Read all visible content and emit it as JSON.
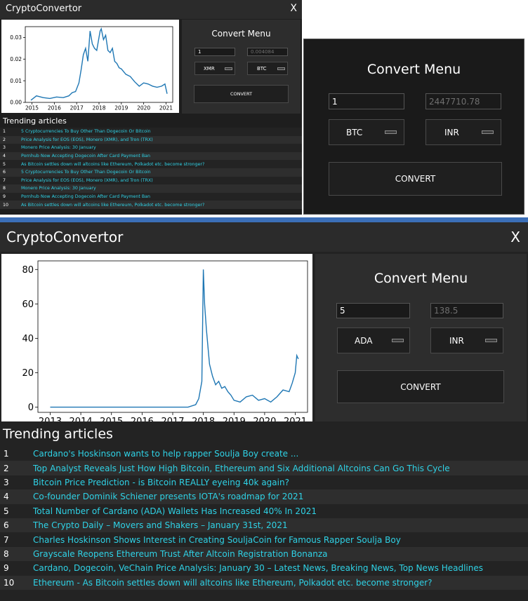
{
  "window_small": {
    "title": "CryptoConvertor",
    "close_label": "X",
    "menu": {
      "title": "Convert Menu",
      "amount": "1",
      "result": "0.004084",
      "from_currency": "XMR",
      "to_currency": "BTC",
      "convert_label": "CONVERT"
    },
    "trending_title": "Trending articles",
    "articles": [
      {
        "num": "1",
        "title": "5 Cryptocurrencies To Buy Other Than Dogecoin Or Bitcoin"
      },
      {
        "num": "2",
        "title": "Price Analysis for EOS (EOS), Monero (XMR), and Tron (TRX)"
      },
      {
        "num": "3",
        "title": "Monero Price Analysis: 30 January"
      },
      {
        "num": "4",
        "title": "Pornhub Now Accepting Dogecoin After Card Payment Ban"
      },
      {
        "num": "5",
        "title": "As Bitcoin settles down will altcoins like Ethereum, Polkadot etc. become stronger?"
      },
      {
        "num": "6",
        "title": "5 Cryptocurrencies To Buy Other Than Dogecoin Or Bitcoin"
      },
      {
        "num": "7",
        "title": "Price Analysis for EOS (EOS), Monero (XMR), and Tron (TRX)"
      },
      {
        "num": "8",
        "title": "Monero Price Analysis: 30 January"
      },
      {
        "num": "9",
        "title": "Pornhub Now Accepting Dogecoin After Card Payment Ban"
      },
      {
        "num": "10",
        "title": "As Bitcoin settles down will altcoins like Ethereum, Polkadot etc. become stronger?"
      }
    ]
  },
  "convert_menu_zoom": {
    "title": "Convert Menu",
    "amount": "1",
    "result": "2447710.78",
    "from_currency": "BTC",
    "to_currency": "INR",
    "convert_label": "CONVERT"
  },
  "window_large": {
    "title": "CryptoConvertor",
    "close_label": "X",
    "menu": {
      "title": "Convert Menu",
      "amount": "5",
      "result": "138.5",
      "from_currency": "ADA",
      "to_currency": "INR",
      "convert_label": "CONVERT"
    },
    "trending_title": "Trending articles",
    "articles": [
      {
        "num": "1",
        "title": "Cardano's Hoskinson wants to help rapper Soulja Boy create ..."
      },
      {
        "num": "2",
        "title": "Top Analyst Reveals Just How High Bitcoin, Ethereum and Six Additional Altcoins Can Go This Cycle"
      },
      {
        "num": "3",
        "title": "Bitcoin Price Prediction - is Bitcoin REALLY eyeing 40k again?"
      },
      {
        "num": "4",
        "title": "Co-founder Dominik Schiener presents IOTA's roadmap for 2021"
      },
      {
        "num": "5",
        "title": "Total Number of Cardano (ADA) Wallets Has Increased 40% In 2021"
      },
      {
        "num": "6",
        "title": "The Crypto Daily – Movers and Shakers – January 31st, 2021"
      },
      {
        "num": "7",
        "title": "Charles Hoskinson Shows Interest in Creating SouljaCoin for Famous Rapper Soulja Boy"
      },
      {
        "num": "8",
        "title": "Grayscale Reopens Ethereum Trust After Altcoin Registration Bonanza"
      },
      {
        "num": "9",
        "title": "Cardano, Dogecoin, VeChain Price Analysis: January 30 – Latest News, Breaking News, Top News Headlines"
      },
      {
        "num": "10",
        "title": "Ethereum - As Bitcoin settles down will altcoins like Ethereum, Polkadot etc. become stronger?"
      }
    ]
  },
  "chart_data": [
    {
      "type": "line",
      "x_tick_labels": [
        "2015",
        "2016",
        "2017",
        "2018",
        "2019",
        "2020",
        "2021"
      ],
      "y_tick_labels": [
        "0.00",
        "0.01",
        "0.02",
        "0.03"
      ],
      "xlim": [
        2014.7,
        2021.3
      ],
      "ylim": [
        0.0,
        0.035
      ],
      "line_color": "#1f77b4",
      "series": [
        {
          "x": [
            2014.95,
            2015.2,
            2015.5,
            2015.8,
            2016.1,
            2016.4,
            2016.65,
            2016.8,
            2016.95,
            2017.1,
            2017.2,
            2017.3,
            2017.4,
            2017.5,
            2017.6,
            2017.7,
            2017.8,
            2017.9,
            2018.0,
            2018.05,
            2018.1,
            2018.2,
            2018.3,
            2018.4,
            2018.5,
            2018.6,
            2018.7,
            2018.8,
            2018.9,
            2019.0,
            2019.2,
            2019.4,
            2019.6,
            2019.8,
            2020.0,
            2020.2,
            2020.4,
            2020.6,
            2020.8,
            2020.95,
            2021.05
          ],
          "y": [
            0.001,
            0.003,
            0.0022,
            0.0018,
            0.0025,
            0.0022,
            0.003,
            0.0045,
            0.005,
            0.009,
            0.015,
            0.022,
            0.025,
            0.019,
            0.033,
            0.027,
            0.025,
            0.024,
            0.03,
            0.033,
            0.034,
            0.029,
            0.031,
            0.024,
            0.023,
            0.025,
            0.019,
            0.018,
            0.016,
            0.0155,
            0.013,
            0.012,
            0.0095,
            0.0075,
            0.009,
            0.0085,
            0.0075,
            0.007,
            0.0075,
            0.0085,
            0.004
          ]
        }
      ]
    },
    {
      "type": "line",
      "x_tick_labels": [
        "2013",
        "2014",
        "2015",
        "2016",
        "2017",
        "2018",
        "2019",
        "2020",
        "2021"
      ],
      "y_tick_labels": [
        "0",
        "20",
        "40",
        "60",
        "80"
      ],
      "xlim": [
        2012.6,
        2021.4
      ],
      "ylim": [
        -3,
        85
      ],
      "line_color": "#1f77b4",
      "series": [
        {
          "x": [
            2013.0,
            2014.0,
            2015.0,
            2016.0,
            2017.0,
            2017.5,
            2017.75,
            2017.85,
            2017.95,
            2018.0,
            2018.04,
            2018.1,
            2018.2,
            2018.3,
            2018.4,
            2018.5,
            2018.6,
            2018.7,
            2018.8,
            2018.9,
            2019.0,
            2019.2,
            2019.4,
            2019.6,
            2019.8,
            2020.0,
            2020.2,
            2020.4,
            2020.6,
            2020.8,
            2020.9,
            2021.0,
            2021.05,
            2021.1
          ],
          "y": [
            0,
            0,
            0,
            0,
            0,
            0,
            1.5,
            5,
            15,
            80,
            60,
            45,
            25,
            18,
            13,
            15,
            11,
            12,
            9,
            7,
            4,
            3,
            6,
            7,
            4,
            5,
            3,
            6,
            10,
            9,
            14,
            20,
            30,
            28
          ]
        }
      ]
    }
  ]
}
